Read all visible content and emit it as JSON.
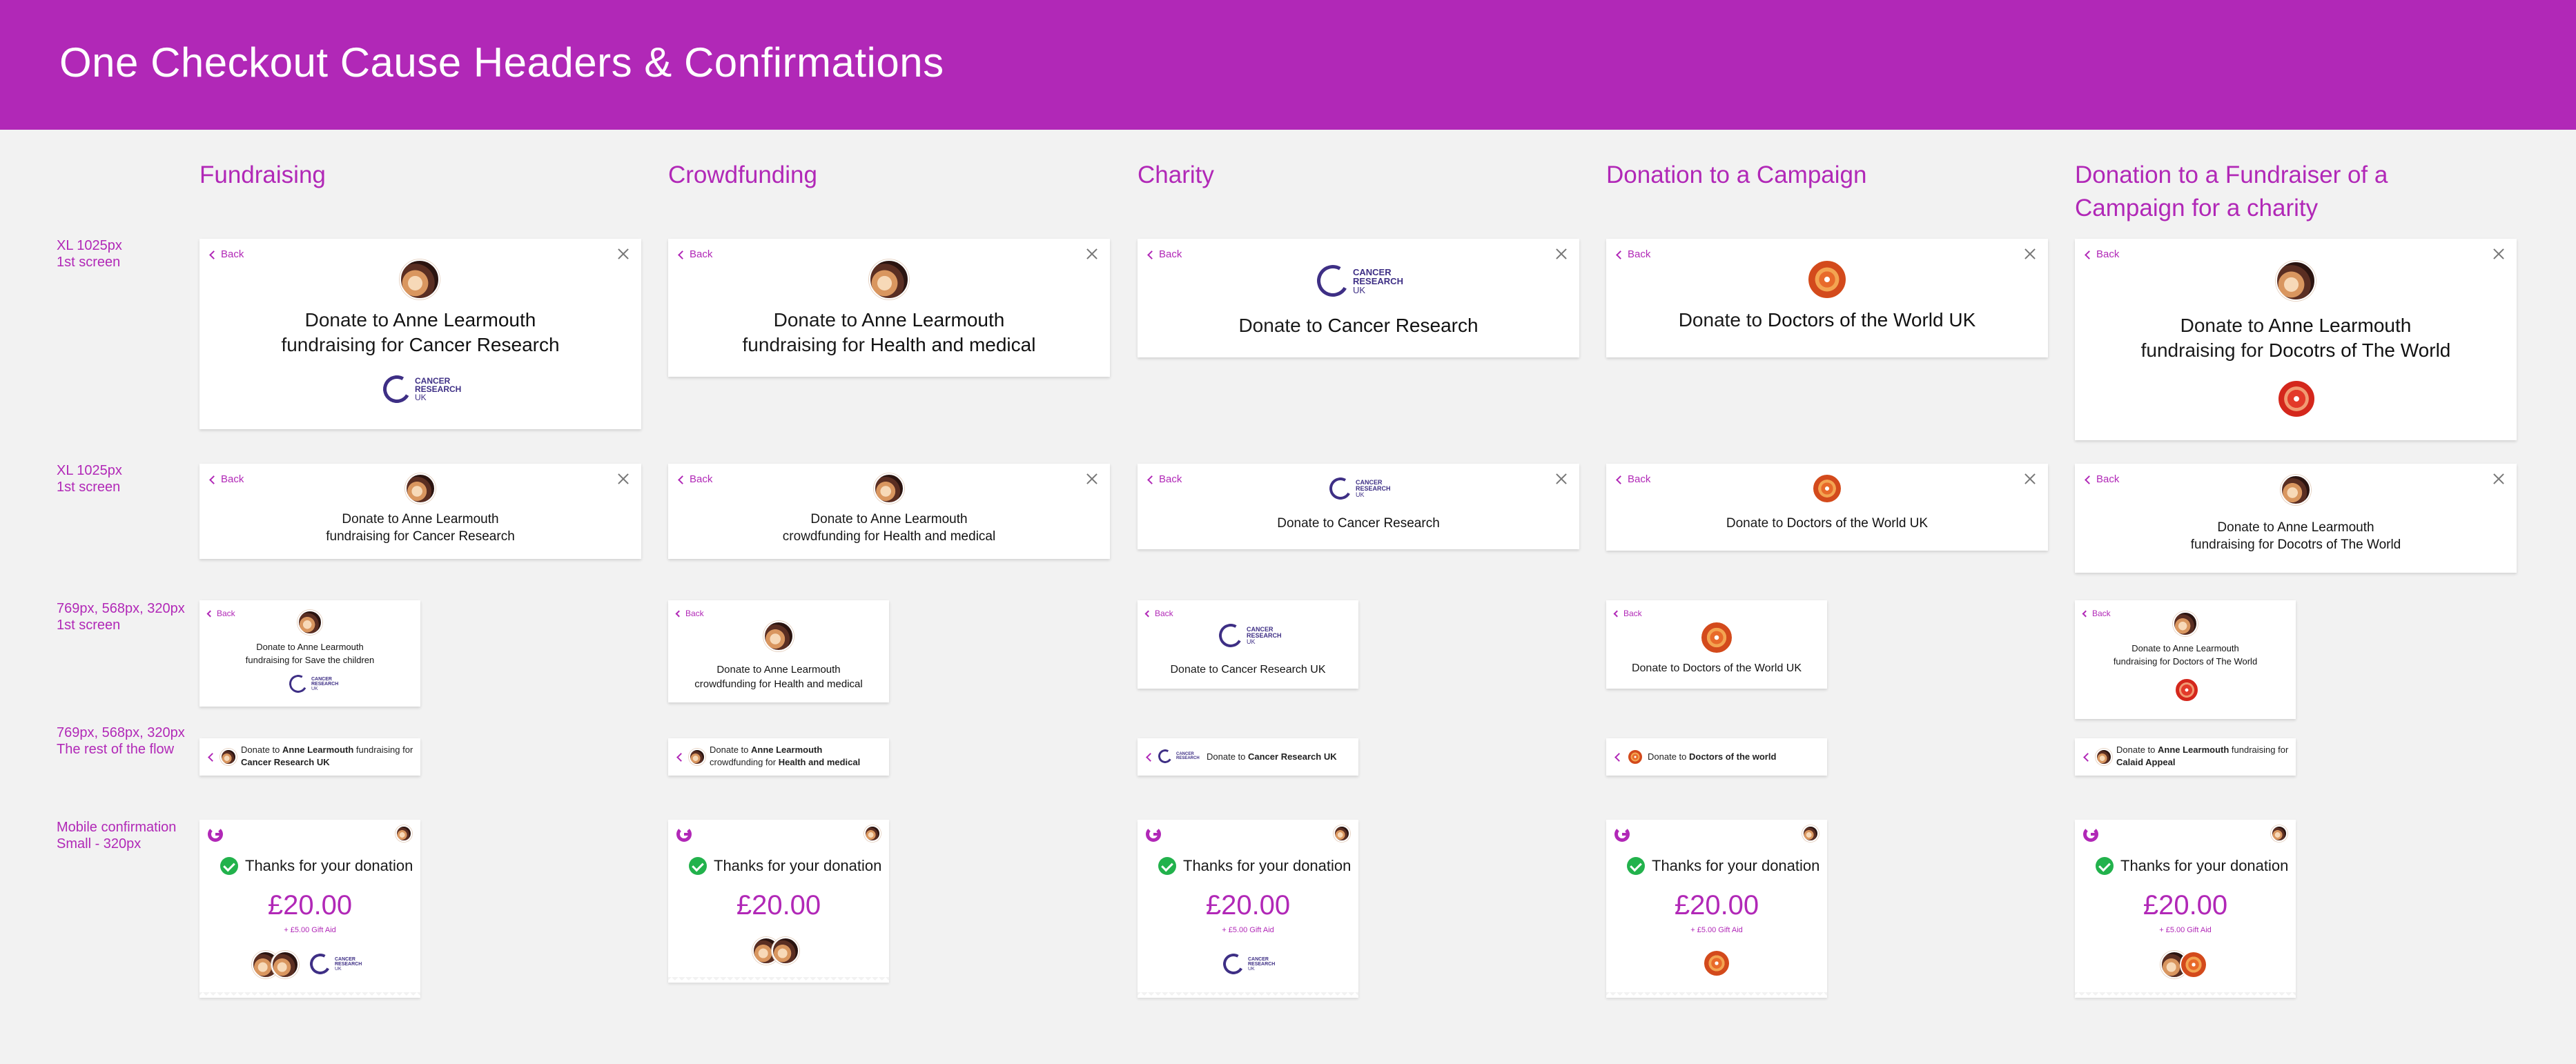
{
  "page": {
    "title": "One Checkout Cause Headers & Confirmations",
    "brand_color": "#b128b7"
  },
  "columns": [
    "Fundraising",
    "Crowdfunding",
    "Charity",
    "Donation to a Campaign",
    "Donation to a Fundraiser of a Campaign for a charity"
  ],
  "rows": [
    "XL 1025px\n1st screen",
    "XL 1025px\n1st screen",
    "769px, 568px, 320px\n1st screen",
    "769px, 568px, 320px\nThe rest of the flow",
    "Mobile confirmation\nSmall - 320px"
  ],
  "common": {
    "back_label": "Back",
    "donate_to": "Donate to",
    "fundraising_for": "fundraising for",
    "crowdfunding_for": "crowdfunding for",
    "thanks": "Thanks for your donation",
    "amount": "£20.00",
    "gift_aid": "+ £5.00 Gift Aid",
    "cruk_logo": [
      "CANCER",
      "RESEARCH",
      "UK"
    ]
  },
  "row1": {
    "fundraising": {
      "name": "Anne Learmouth",
      "cause": "Cancer Research"
    },
    "crowdfunding": {
      "name": "Anne Learmouth",
      "cause": "Health and medical"
    },
    "charity": {
      "cause": "Cancer Research"
    },
    "campaign": {
      "cause": "Doctors of the World UK"
    },
    "fundraiser_campaign": {
      "name": "Anne Learmouth",
      "cause": "Docotrs of The World"
    }
  },
  "row2": {
    "fundraising": {
      "name": "Anne Learmouth",
      "cause": "Cancer Research"
    },
    "crowdfunding": {
      "name": "Anne Learmouth",
      "cause": "Health and medical"
    },
    "charity": {
      "cause": "Cancer Research"
    },
    "campaign": {
      "cause": "Doctors of the World UK"
    },
    "fundraiser_campaign": {
      "name": "Anne Learmouth",
      "cause": "Docotrs of The World"
    }
  },
  "row3": {
    "fundraising": {
      "name": "Anne Learmouth",
      "cause": "Save the children"
    },
    "crowdfunding": {
      "name": "Anne Learmouth",
      "cause": "Health and medical"
    },
    "charity": {
      "cause": "Cancer Research UK"
    },
    "campaign": {
      "cause": "Doctors of the World UK"
    },
    "fundraiser_campaign": {
      "name": "Anne Learmouth",
      "cause": "Doctors of The World"
    }
  },
  "row4": {
    "fundraising": {
      "name": "Anne Learmouth",
      "cause": "Cancer Research UK"
    },
    "crowdfunding": {
      "name": "Anne Learmouth",
      "cause": "Health and medical"
    },
    "charity": {
      "cause": "Cancer Research UK"
    },
    "campaign": {
      "cause": "Doctors of the world"
    },
    "fundraiser_campaign": {
      "name": "Anne Learmouth",
      "cause": "Calaid Appeal"
    }
  }
}
